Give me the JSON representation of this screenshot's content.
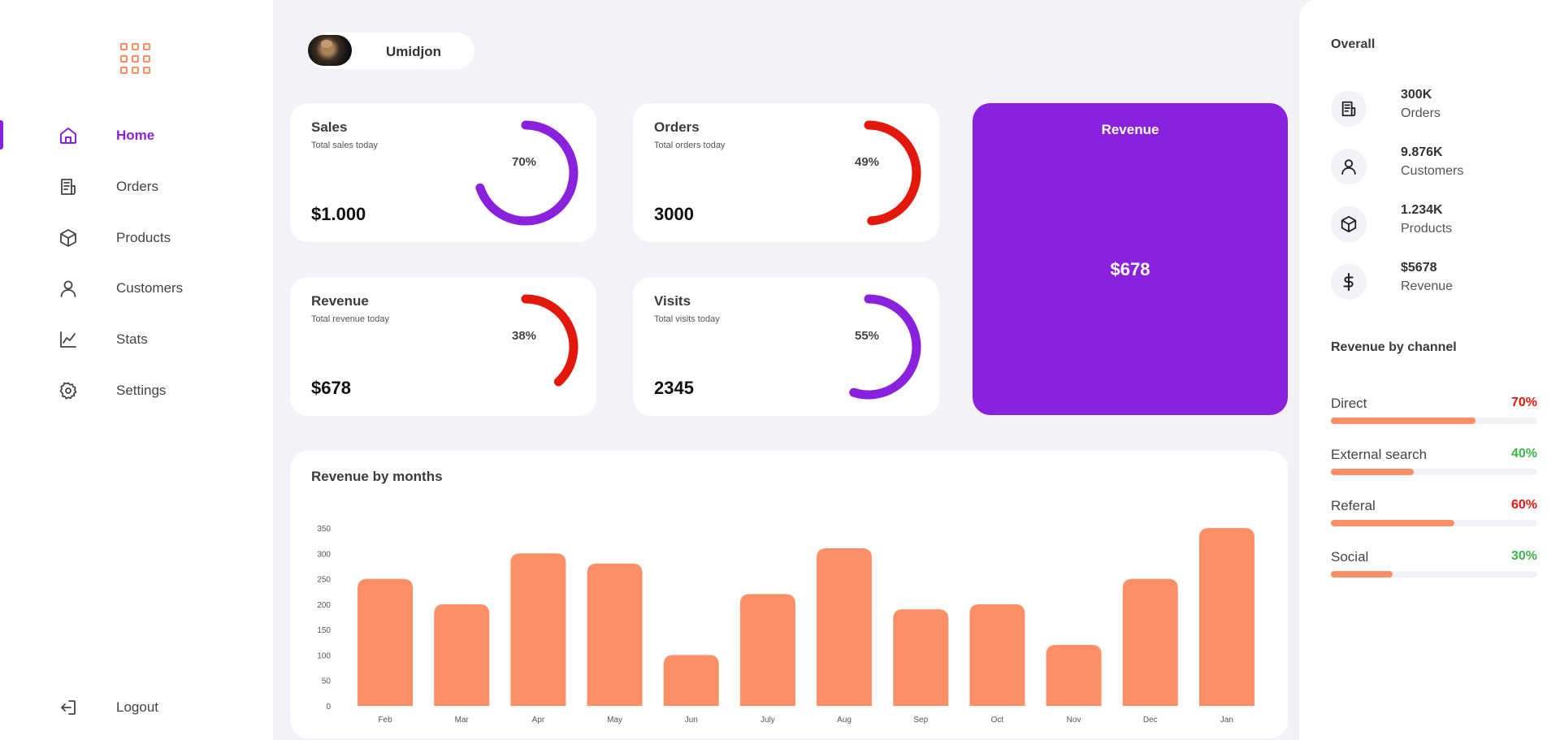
{
  "sidebar": {
    "logo_icon": "grid-apps-icon",
    "items": [
      {
        "label": "Home",
        "icon": "home-icon",
        "active": true
      },
      {
        "label": "Orders",
        "icon": "receipt-icon",
        "active": false
      },
      {
        "label": "Products",
        "icon": "box-icon",
        "active": false
      },
      {
        "label": "Customers",
        "icon": "user-icon",
        "active": false
      },
      {
        "label": "Stats",
        "icon": "line-chart-icon",
        "active": false
      },
      {
        "label": "Settings",
        "icon": "gear-icon",
        "active": false
      }
    ],
    "logout": {
      "label": "Logout",
      "icon": "logout-icon"
    }
  },
  "profile": {
    "name": "Umidjon"
  },
  "cards": [
    {
      "title": "Sales",
      "subtitle": "Total sales today",
      "value": "$1.000",
      "percent_label": "70%",
      "percent": 70,
      "color": "#8a22dd"
    },
    {
      "title": "Orders",
      "subtitle": "Total orders today",
      "value": "3000",
      "percent_label": "49%",
      "percent": 49,
      "color": "#e3180c"
    },
    {
      "title": "Revenue",
      "subtitle": "Total revenue today",
      "value": "$678",
      "percent_label": "38%",
      "percent": 38,
      "color": "#e3180c"
    },
    {
      "title": "Visits",
      "subtitle": "Total visits today",
      "value": "2345",
      "percent_label": "55%",
      "percent": 55,
      "color": "#8a22dd"
    }
  ],
  "revenue_card": {
    "title": "Revenue",
    "value": "$678",
    "color": "#8a22dd"
  },
  "chart_data": {
    "type": "bar",
    "title": "Revenue by months",
    "categories": [
      "Feb",
      "Mar",
      "Apr",
      "May",
      "Jun",
      "July",
      "Aug",
      "Sep",
      "Oct",
      "Nov",
      "Dec",
      "Jan"
    ],
    "values": [
      250,
      200,
      300,
      280,
      100,
      220,
      310,
      190,
      200,
      120,
      250,
      350
    ],
    "yticks": [
      0,
      50,
      100,
      150,
      200,
      250,
      300,
      350
    ],
    "ylim": [
      0,
      350
    ],
    "color": "#fd8f66",
    "grid": false
  },
  "overall": {
    "title": "Overall",
    "items": [
      {
        "value": "300K",
        "label": "Orders",
        "icon": "receipt-icon"
      },
      {
        "value": "9.876K",
        "label": "Customers",
        "icon": "user-icon"
      },
      {
        "value": "1.234K",
        "label": "Products",
        "icon": "box-icon"
      },
      {
        "value": "$5678",
        "label": "Revenue",
        "icon": "dollar-icon"
      }
    ]
  },
  "channels": {
    "title": "Revenue by channel",
    "items": [
      {
        "label": "Direct",
        "percent_label": "70%",
        "percent": 70,
        "color": "#e3180c"
      },
      {
        "label": "External search",
        "percent_label": "40%",
        "percent": 40,
        "color": "#3bb54a"
      },
      {
        "label": "Referal",
        "percent_label": "60%",
        "percent": 60,
        "color": "#e3180c"
      },
      {
        "label": "Social",
        "percent_label": "30%",
        "percent": 30,
        "color": "#3bb54a"
      }
    ],
    "bar_color": "#fd8f66"
  }
}
